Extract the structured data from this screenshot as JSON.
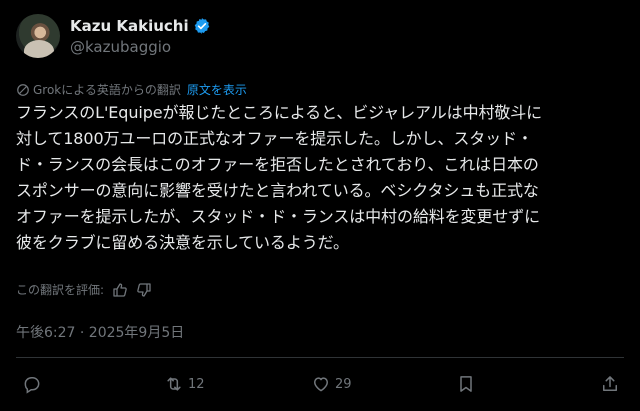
{
  "user": {
    "display_name": "Kazu Kakiuchi",
    "handle": "@kazubaggio",
    "verified": true
  },
  "translation": {
    "label": "Grokによる英語からの翻訳",
    "show_original": "原文を表示"
  },
  "tweet": {
    "lines": [
      "フランスのL'Equipeが報じたところによると、ビジャレアルは中村敬斗に",
      "対して1800万ユーロの正式なオファーを提示した。しかし、スタッド・",
      "ド・ランスの会長はこのオファーを拒否したとされており、これは日本の",
      "スポンサーの意向に影響を受けたと言われている。ベシクタシュも正式な",
      "オファーを提示したが、スタッド・ド・ランスは中村の給料を変更せずに",
      "彼をクラブに留める決意を示しているようだ。"
    ]
  },
  "rating": {
    "label": "この翻訳を評価:"
  },
  "timestamp": "午後6:27 · 2025年9月5日",
  "actions": {
    "reply_icon": "reply-icon",
    "retweet_count": "12",
    "like_count": "29",
    "bookmark_icon": "bookmark-icon",
    "share_icon": "share-icon"
  },
  "colors": {
    "background": "#000000",
    "text": "#e7e9ea",
    "secondary": "#71767b",
    "link": "#1d9bf0",
    "divider": "#2f3336"
  }
}
